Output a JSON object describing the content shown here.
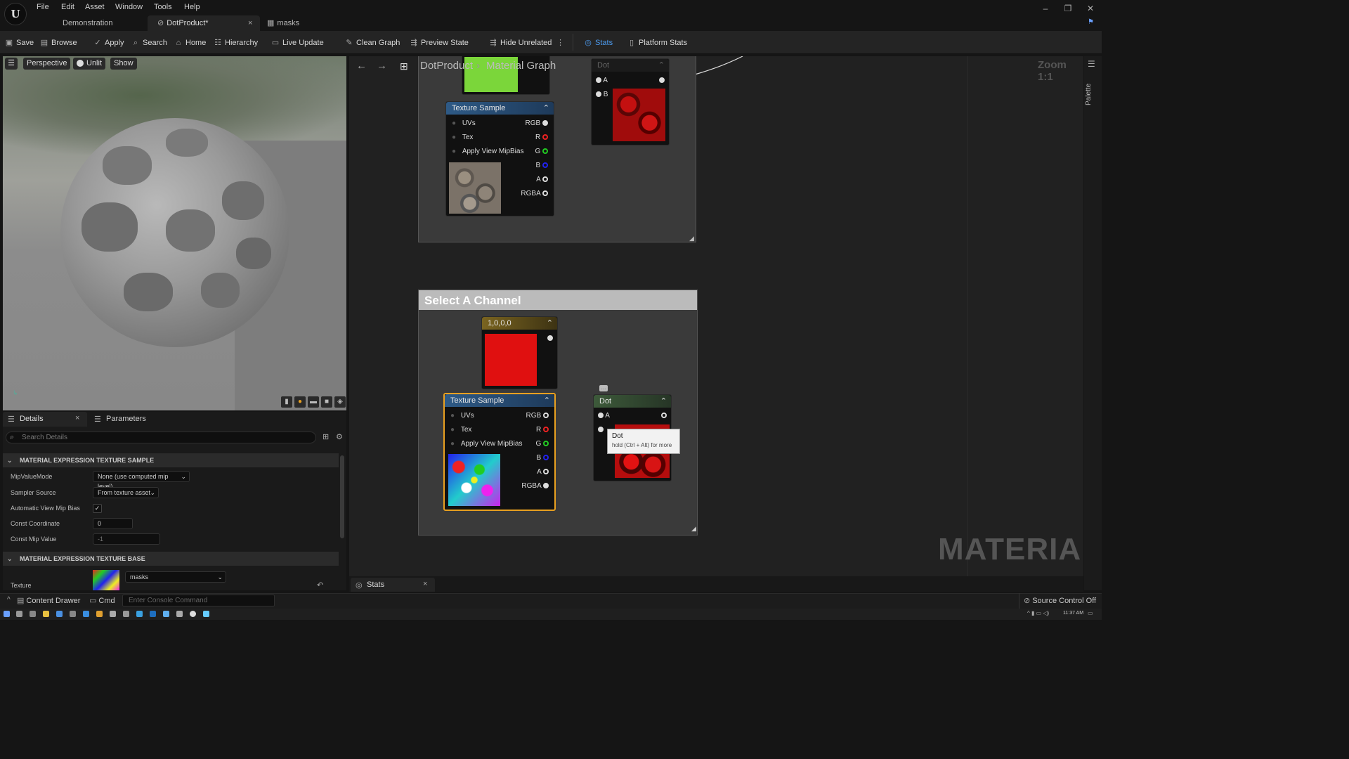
{
  "menu": [
    "File",
    "Edit",
    "Asset",
    "Window",
    "Tools",
    "Help"
  ],
  "tabs": [
    "Demonstration",
    "DotProduct*",
    "masks"
  ],
  "toolbar": {
    "save": "Save",
    "browse": "Browse",
    "apply": "Apply",
    "search": "Search",
    "home": "Home",
    "hierarchy": "Hierarchy",
    "live_update": "Live Update",
    "clean_graph": "Clean Graph",
    "preview_state": "Preview State",
    "hide_unrelated": "Hide Unrelated",
    "stats": "Stats",
    "platform_stats": "Platform Stats"
  },
  "viewport": {
    "perspective": "Perspective",
    "unlit": "Unlit",
    "show": "Show"
  },
  "graph": {
    "breadcrumb_root": "DotProduct",
    "breadcrumb_leaf": "Material Graph",
    "zoom": "Zoom 1:1",
    "palette": "Palette",
    "watermark": "MATERIAL",
    "comment_title": "Select A Channel"
  },
  "node_tex_top": {
    "title": "Texture Sample",
    "uvs": "UVs",
    "tex": "Tex",
    "mip": "Apply View MipBias",
    "rgb": "RGB",
    "r": "R",
    "g": "G",
    "b": "B",
    "a": "A",
    "rgba": "RGBA"
  },
  "node_tex_bot": {
    "title": "Texture Sample",
    "uvs": "UVs",
    "tex": "Tex",
    "mip": "Apply View MipBias",
    "rgb": "RGB",
    "r": "R",
    "g": "G",
    "b": "B",
    "a": "A",
    "rgba": "RGBA"
  },
  "node_dot_top": {
    "title": "Dot",
    "a": "A",
    "b": "B"
  },
  "node_const": {
    "title": "1,0,0,0"
  },
  "node_dot_bot": {
    "title": "Dot",
    "a": "A"
  },
  "tooltip": {
    "title": "Dot",
    "hint": "hold (Ctrl + Alt) for more"
  },
  "details": {
    "tab_details": "Details",
    "tab_parameters": "Parameters",
    "search_placeholder": "Search Details",
    "sect1": "MATERIAL EXPRESSION TEXTURE SAMPLE",
    "mip_mode_label": "MipValueMode",
    "mip_mode_value": "None (use computed mip level)",
    "sampler_label": "Sampler Source",
    "sampler_value": "From texture asset",
    "auto_mip_label": "Automatic View Mip Bias",
    "const_coord_label": "Const Coordinate",
    "const_coord_value": "0",
    "const_mip_label": "Const Mip Value",
    "const_mip_value": "-1",
    "sect2": "MATERIAL EXPRESSION TEXTURE BASE",
    "texture_label": "Texture",
    "texture_value": "masks"
  },
  "stats_tab": "Stats",
  "bottom": {
    "content_drawer": "Content Drawer",
    "cmd": "Cmd",
    "console_placeholder": "Enter Console Command",
    "source_control": "Source Control Off"
  },
  "clock": "11:37 AM",
  "colors": {
    "accent": "#2b7fd8",
    "red": "#e01010",
    "green": "#7bd63a",
    "selected": "#e8a020"
  }
}
